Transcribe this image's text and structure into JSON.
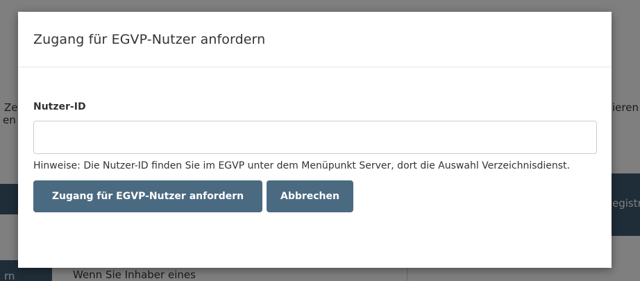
{
  "background": {
    "left_text_1": "Ze",
    "left_text_2": "en",
    "right_text": "ieren",
    "left_block_text": "rn",
    "right_block_text": "egistr",
    "bottom_text": "Wenn Sie Inhaber eines"
  },
  "modal": {
    "title": "Zugang für EGVP-Nutzer anfordern",
    "field_label": "Nutzer-ID",
    "field_value": "",
    "field_placeholder": "",
    "hint": "Hinweise: Die Nutzer-ID finden Sie im EGVP unter dem Menüpunkt Server, dort die Auswahl Verzeichnisdienst.",
    "primary_button": "Zugang für EGVP-Nutzer anfordern",
    "cancel_button": "Abbrechen"
  },
  "colors": {
    "button": "#4a6a82",
    "overlay": "rgba(0,0,0,0.5)"
  }
}
